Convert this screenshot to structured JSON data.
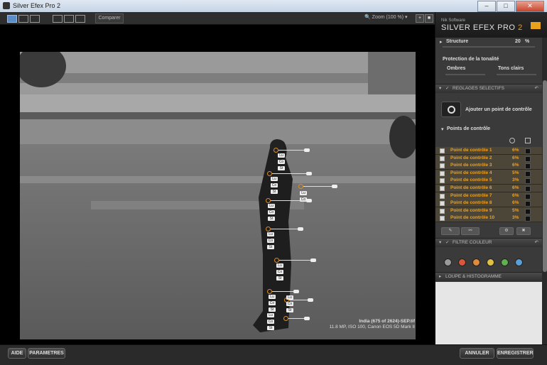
{
  "window": {
    "title": "Silver Efex Pro 2",
    "minimize": "–",
    "maximize": "□",
    "close": "✕"
  },
  "toolbar": {
    "compare_label": "Comparer",
    "zoom_label": "Zoom (100 %)"
  },
  "image_info": {
    "filename": "India (675 of 2624)-SEP.tif",
    "details": "11.8 MP, ISO 100, Canon EOS 5D Mark II"
  },
  "panel": {
    "brand_small": "Nik Software",
    "brand_name": "SILVER EFEX PRO",
    "brand_version": "2",
    "structure_label": "Structure",
    "structure_value": "20",
    "structure_unit": "%",
    "tone_protection_label": "Protection de la tonalité",
    "shadows_label": "Ombres",
    "highlights_label": "Tons clairs",
    "selective_header": "REGLAGES SELECTIFS",
    "add_cp_label": "Ajouter un point de contrôle",
    "cp_header": "Points de contrôle",
    "control_points": [
      {
        "name": "Point de contrôle 1",
        "pct": "6%"
      },
      {
        "name": "Point de contrôle 2",
        "pct": "6%"
      },
      {
        "name": "Point de contrôle 3",
        "pct": "6%"
      },
      {
        "name": "Point de contrôle 4",
        "pct": "5%"
      },
      {
        "name": "Point de contrôle 5",
        "pct": "3%"
      },
      {
        "name": "Point de contrôle 6",
        "pct": "6%"
      },
      {
        "name": "Point de contrôle 7",
        "pct": "6%"
      },
      {
        "name": "Point de contrôle 8",
        "pct": "6%"
      },
      {
        "name": "Point de contrôle 9",
        "pct": "5%"
      },
      {
        "name": "Point de contrôle 10",
        "pct": "3%"
      }
    ],
    "color_filter_header": "FILTRE COULEUR",
    "filter_colors": [
      "#9a9a9a",
      "#d9573a",
      "#e08a3a",
      "#e0c040",
      "#60b050",
      "#5aa0d8"
    ],
    "loupe_header": "LOUPE & HISTOGRAMME"
  },
  "buttons": {
    "help": "AIDE",
    "settings": "PARAMETRES",
    "cancel": "ANNULER",
    "save": "ENREGISTRER"
  },
  "tags": {
    "lu": "Lu",
    "co": "Co",
    "st": "St"
  }
}
